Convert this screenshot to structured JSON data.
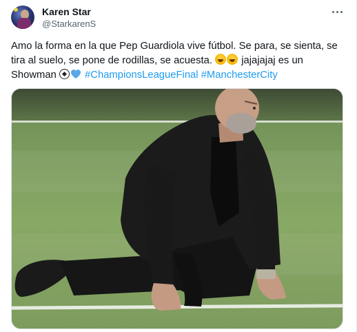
{
  "tweet": {
    "author_name": "Karen Star",
    "author_handle": "@StarkarenS",
    "text": {
      "line1": "Amo la forma en la que Pep Guardiola vive  fútbol. Se para, se sienta, se",
      "line2": "tira al suelo, se pone de rodillas, se acuesta. ",
      "line2_tail": " jajajajaj es un",
      "line3_start": "Showman ",
      "hashtags": [
        "#ChampionsLeagueFinal",
        "#ManchesterCity"
      ]
    },
    "emojis": [
      "rolling-on-floor-laughing",
      "rolling-on-floor-laughing",
      "soccer-ball",
      "blue-heart"
    ],
    "more_icon": "more-horizontal-icon",
    "colors": {
      "text": "#0f1419",
      "secondary": "#536471",
      "link": "#1d9bf0",
      "heart": "#5ba8e8",
      "pitch": "#7d9d5f"
    }
  }
}
